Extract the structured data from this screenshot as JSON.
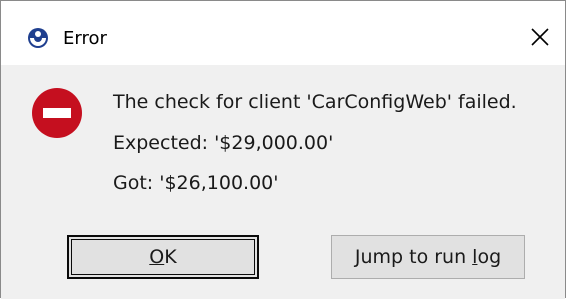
{
  "window": {
    "title": "Error",
    "app_icon": "app-logo-icon",
    "close_icon": "close-icon"
  },
  "message": {
    "icon": "error-icon",
    "line1": "The check for client 'CarConfigWeb' failed.",
    "line2": "Expected: '$29,000.00'",
    "line3": "Got: '$26,100.00'"
  },
  "buttons": {
    "ok": {
      "mnemonic": "O",
      "rest": "K"
    },
    "jump": {
      "pre": "Jump to run ",
      "mnemonic": "l",
      "post": "og"
    }
  },
  "colors": {
    "error_red": "#c50f1f",
    "app_blue": "#1f3f8f"
  }
}
